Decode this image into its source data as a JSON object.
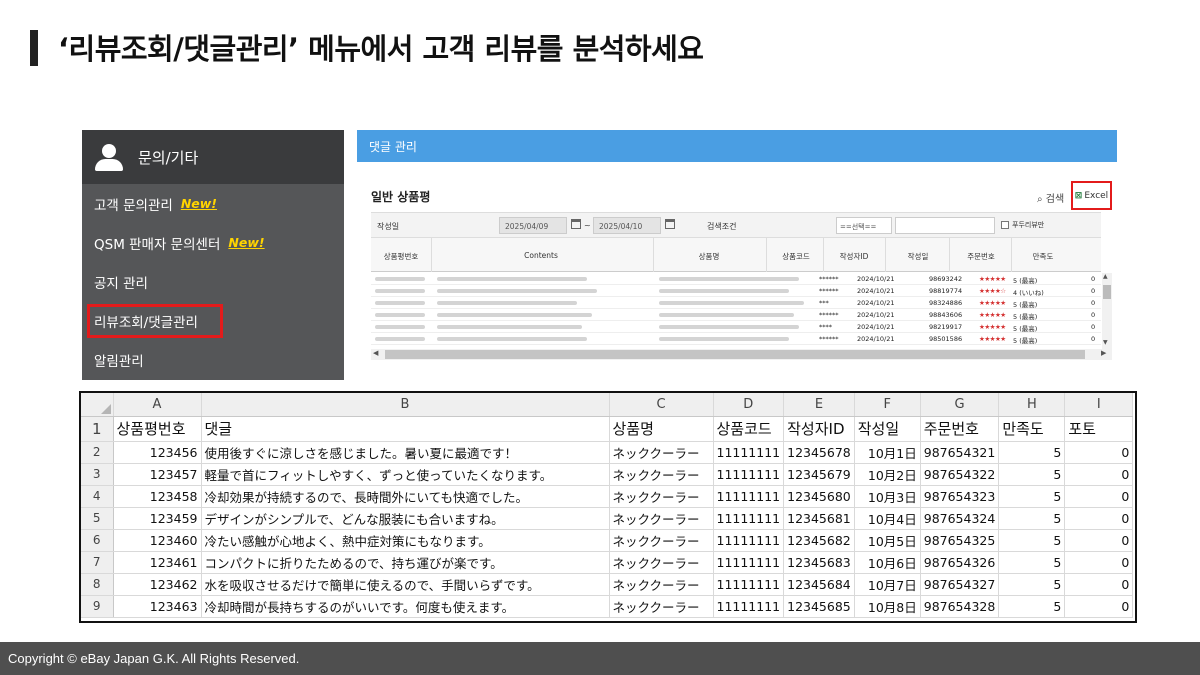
{
  "page": {
    "title": "‘리뷰조회/댓글관리’ 메뉴에서 고객 리뷰를 분석하세요",
    "footer": "Copyright © eBay Japan G.K. All Rights Reserved."
  },
  "sidebar": {
    "header": "문의/기타",
    "items": [
      {
        "label": "고객 문의관리",
        "badge": "New!"
      },
      {
        "label": "QSM 판매자 문의센터",
        "badge": "New!"
      },
      {
        "label": "공지 관리"
      },
      {
        "label": "리뷰조회/댓글관리"
      },
      {
        "label": "알림관리"
      }
    ]
  },
  "panel": {
    "header": "댓글 관리",
    "subtitle": "일반 상품평",
    "search_label": "검색",
    "excel_label": "Excel",
    "filter": {
      "date_label": "작성일",
      "date_from": "2025/04/09",
      "date_sep": "~",
      "date_to": "2025/04/10",
      "cond_label": "검색조건",
      "select_value": "==선택==",
      "checkbox_label": "푸두리뷰만"
    },
    "columns": [
      "상품평번호",
      "Contents",
      "상품명",
      "상품코드",
      "작성자ID",
      "작성일",
      "주문번호",
      "만족도"
    ],
    "rows": [
      {
        "writer": "******",
        "date": "2024/10/21",
        "order": "98693242",
        "stars": "★★★★★",
        "rating": "5 (最高)",
        "extra": "0"
      },
      {
        "writer": "******",
        "date": "2024/10/21",
        "order": "98819774",
        "stars": "★★★★☆",
        "rating": "4 (いいね)",
        "extra": "0"
      },
      {
        "writer": "***",
        "date": "2024/10/21",
        "order": "98324886",
        "stars": "★★★★★",
        "rating": "5 (最高)",
        "extra": "0"
      },
      {
        "writer": "******",
        "date": "2024/10/21",
        "order": "98843606",
        "stars": "★★★★★",
        "rating": "5 (最高)",
        "extra": "0"
      },
      {
        "writer": "****",
        "date": "2024/10/21",
        "order": "98219917",
        "stars": "★★★★★",
        "rating": "5 (最高)",
        "extra": "0"
      },
      {
        "writer": "******",
        "date": "2024/10/21",
        "order": "98501586",
        "stars": "★★★★★",
        "rating": "5 (最高)",
        "extra": "0"
      }
    ]
  },
  "sheet": {
    "col_letters": [
      "A",
      "B",
      "C",
      "D",
      "E",
      "F",
      "G",
      "H",
      "I"
    ],
    "headers": [
      "상품평번호",
      "댓글",
      "상품명",
      "상품코드",
      "작성자ID",
      "작성일",
      "주문번호",
      "만족도",
      "포토"
    ],
    "rows": [
      {
        "num": "2",
        "cells": [
          "123456",
          "使用後すぐに涼しさを感じました。暑い夏に最適です！",
          "ネッククーラー",
          "11111111",
          "12345678",
          "10月1日",
          "987654321",
          "5",
          "0"
        ]
      },
      {
        "num": "3",
        "cells": [
          "123457",
          "軽量で首にフィットしやすく、ずっと使っていたくなります。",
          "ネッククーラー",
          "11111111",
          "12345679",
          "10月2日",
          "987654322",
          "5",
          "0"
        ]
      },
      {
        "num": "4",
        "cells": [
          "123458",
          "冷却効果が持続するので、長時間外にいても快適でした。",
          "ネッククーラー",
          "11111111",
          "12345680",
          "10月3日",
          "987654323",
          "5",
          "0"
        ]
      },
      {
        "num": "5",
        "cells": [
          "123459",
          "デザインがシンプルで、どんな服装にも合いますね。",
          "ネッククーラー",
          "11111111",
          "12345681",
          "10月4日",
          "987654324",
          "5",
          "0"
        ]
      },
      {
        "num": "6",
        "cells": [
          "123460",
          "冷たい感触が心地よく、熱中症対策にもなります。",
          "ネッククーラー",
          "11111111",
          "12345682",
          "10月5日",
          "987654325",
          "5",
          "0"
        ]
      },
      {
        "num": "7",
        "cells": [
          "123461",
          "コンパクトに折りたためるので、持ち運びが楽です。",
          "ネッククーラー",
          "11111111",
          "12345683",
          "10月6日",
          "987654326",
          "5",
          "0"
        ]
      },
      {
        "num": "8",
        "cells": [
          "123462",
          "水を吸収させるだけで簡単に使えるので、手間いらずです。",
          "ネッククーラー",
          "11111111",
          "12345684",
          "10月7日",
          "987654327",
          "5",
          "0"
        ]
      },
      {
        "num": "9",
        "cells": [
          "123463",
          "冷却時間が長持ちするのがいいです。何度も使えます。",
          "ネッククーラー",
          "11111111",
          "12345685",
          "10月8日",
          "987654328",
          "5",
          "0"
        ]
      }
    ]
  }
}
